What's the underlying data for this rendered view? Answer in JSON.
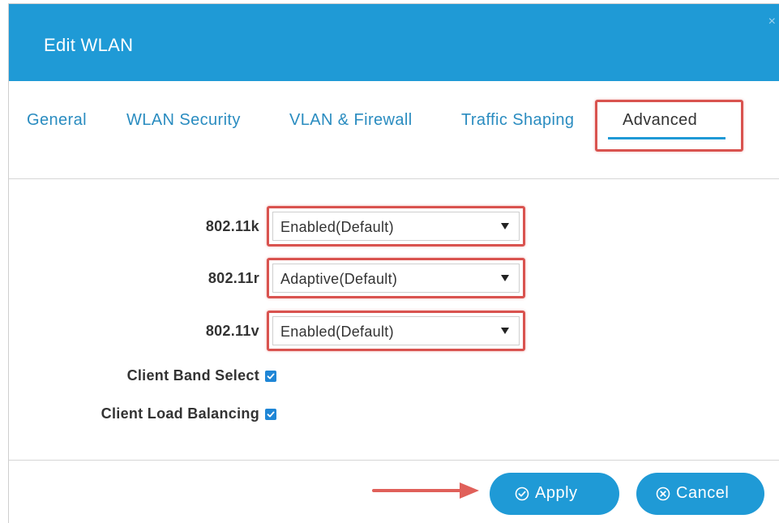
{
  "dialog": {
    "title": "Edit WLAN",
    "close_label": "×"
  },
  "tabs": [
    {
      "label": "General",
      "active": false
    },
    {
      "label": "WLAN Security",
      "active": false
    },
    {
      "label": "VLAN & Firewall",
      "active": false
    },
    {
      "label": "Traffic Shaping",
      "active": false
    },
    {
      "label": "Advanced",
      "active": true
    }
  ],
  "fields": {
    "dot11k": {
      "label": "802.11k",
      "value": "Enabled(Default)"
    },
    "dot11r": {
      "label": "802.11r",
      "value": "Adaptive(Default)"
    },
    "dot11v": {
      "label": "802.11v",
      "value": "Enabled(Default)"
    },
    "client_band_select": {
      "label": "Client Band Select",
      "checked": true
    },
    "client_load_balancing": {
      "label": "Client Load Balancing",
      "checked": true
    }
  },
  "buttons": {
    "apply_label": "Apply",
    "cancel_label": "Cancel"
  },
  "colors": {
    "header": "#1f9ad6",
    "highlight": "#d9534f",
    "link": "#2a8cc0",
    "checkbox": "#1f86d6"
  }
}
